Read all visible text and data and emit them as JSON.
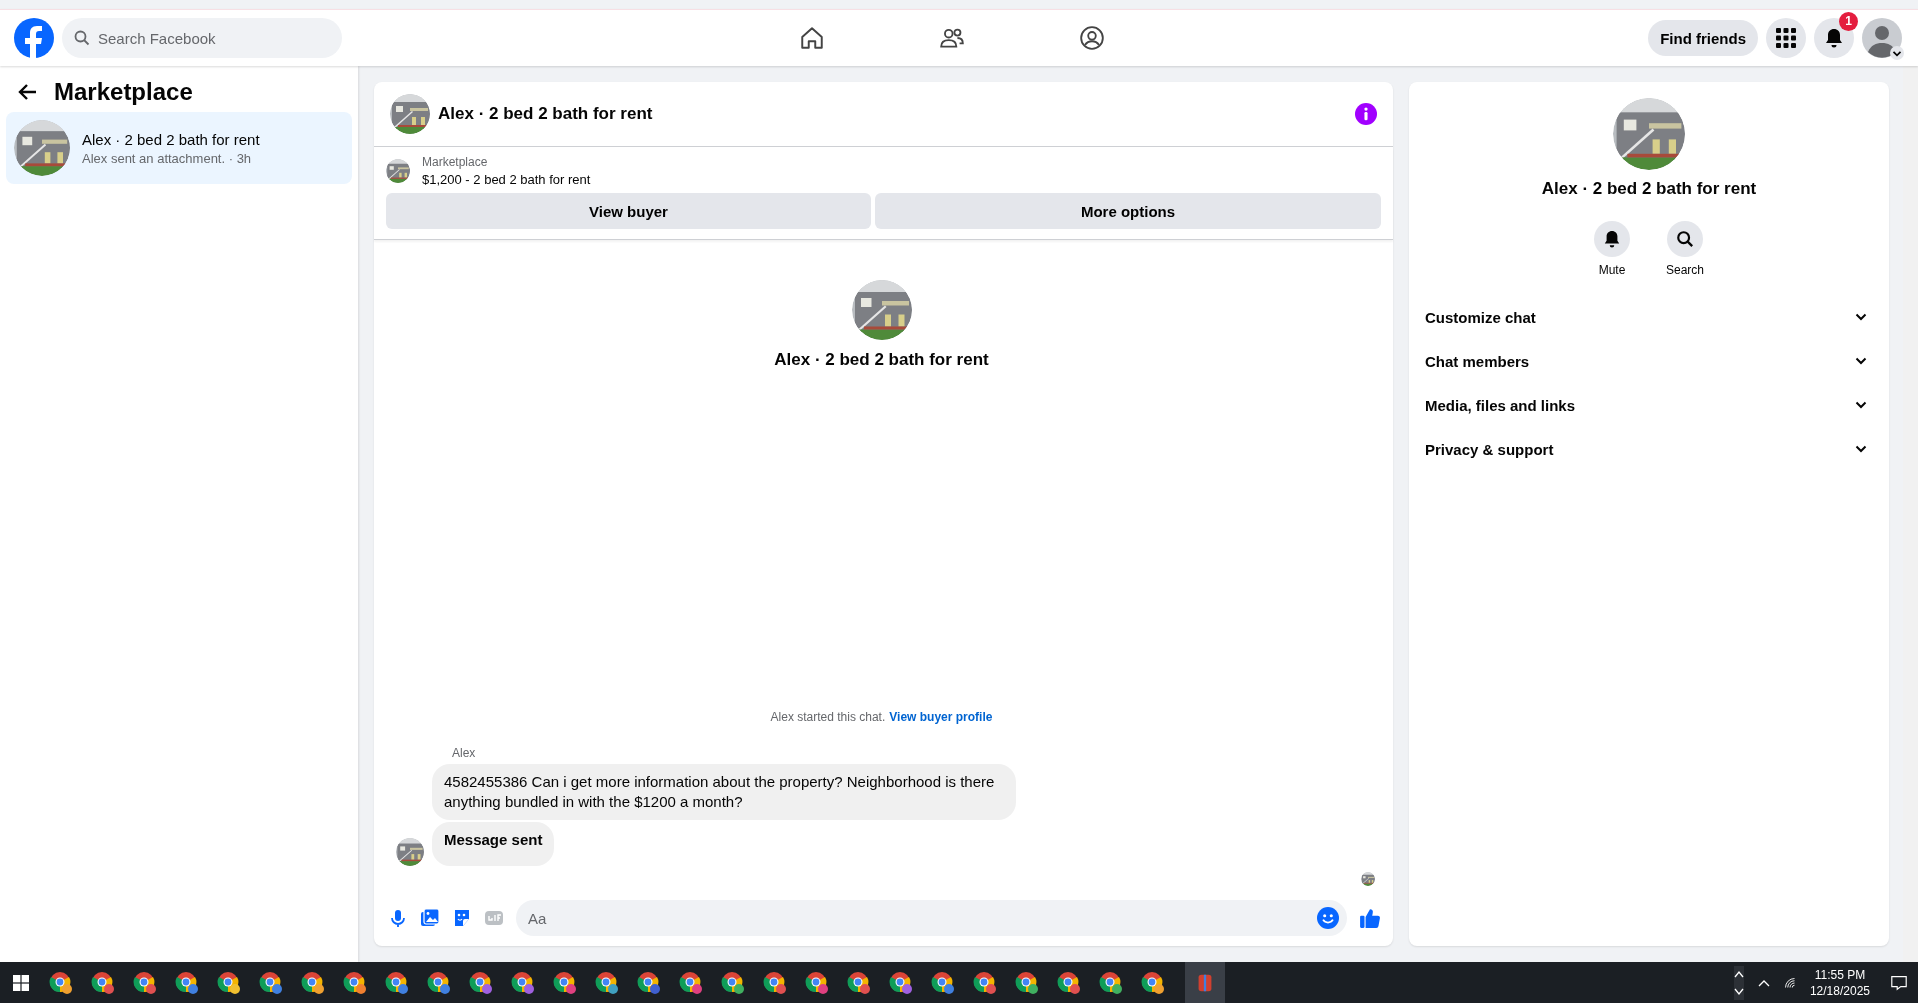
{
  "topbar": {
    "search": {
      "placeholder": "Search Facebook"
    },
    "find_friends": "Find friends",
    "notification_count": "1"
  },
  "sidebar": {
    "title": "Marketplace",
    "conversations": [
      {
        "title": "Alex · 2 bed 2 bath for rent",
        "preview": "Alex sent an attachment. · 3h",
        "selected": true
      }
    ]
  },
  "chat": {
    "title": "Alex · 2 bed 2 bath for rent",
    "listing": {
      "source": "Marketplace",
      "summary": "$1,200 - 2 bed 2 bath for rent"
    },
    "buttons": [
      "View buyer",
      "More options"
    ],
    "intro_name": "Alex · 2 bed 2 bath for rent",
    "started_note": "Alex started this chat.",
    "started_link": "View buyer profile",
    "sender": "Alex",
    "bubbles": [
      {
        "kind": "text",
        "text": "4582455386 Can i get more information about the property? Neighborhood is there anything bundled in with the $1200 a month?"
      },
      {
        "kind": "notice",
        "text": "Message sent"
      }
    ],
    "composer": {
      "placeholder": "Aa"
    }
  },
  "details": {
    "name": "Alex · 2 bed 2 bath for rent",
    "actions": [
      {
        "kind": "mute",
        "label": "Mute"
      },
      {
        "kind": "search",
        "label": "Search"
      }
    ],
    "sections": [
      {
        "label": "Customize chat",
        "expanded": false
      },
      {
        "label": "Chat members",
        "expanded": false
      },
      {
        "label": "Media, files and links",
        "expanded": false
      },
      {
        "label": "Privacy & support",
        "expanded": false
      }
    ]
  },
  "taskbar": {
    "apps": [
      {
        "color": "#f0a030"
      },
      {
        "color": "#e05050"
      },
      {
        "color": "#e05050"
      },
      {
        "color": "#4080e0"
      },
      {
        "color": "#f0c030"
      },
      {
        "color": "#4080e0"
      },
      {
        "color": "#f0a030"
      },
      {
        "color": "#f08030"
      },
      {
        "color": "#4080e0"
      },
      {
        "color": "#4080e0"
      },
      {
        "color": "#a060e0"
      },
      {
        "color": "#a060e0"
      },
      {
        "color": "#e04080"
      },
      {
        "color": "#40a0c0"
      },
      {
        "color": "#4060d0"
      },
      {
        "color": "#e04080"
      },
      {
        "color": "#40b060"
      },
      {
        "color": "#e05050"
      },
      {
        "color": "#e04080"
      },
      {
        "color": "#e05050"
      },
      {
        "color": "#a060e0"
      },
      {
        "color": "#4080e0"
      },
      {
        "color": "#e05050"
      },
      {
        "color": "#40b060"
      },
      {
        "color": "#e05050"
      },
      {
        "color": "#40b060"
      },
      {
        "color": "#f0a030"
      }
    ],
    "time": "11:55 PM",
    "date": "12/18/2025"
  }
}
